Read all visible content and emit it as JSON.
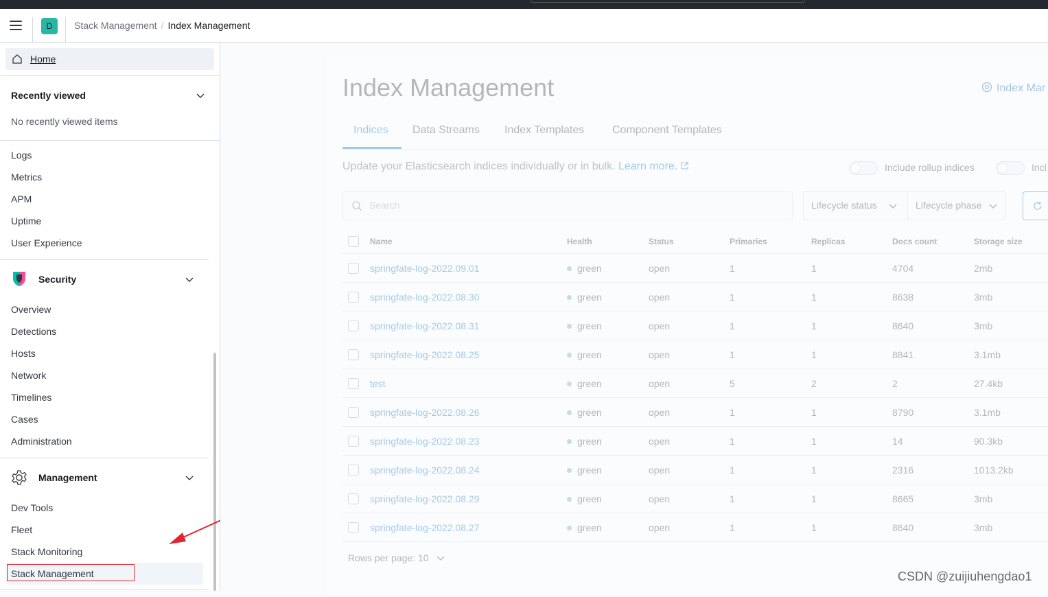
{
  "header": {
    "space_initial": "D",
    "breadcrumbs": [
      "Stack Management",
      "Index Management"
    ]
  },
  "sidebar": {
    "home": "Home",
    "recently_viewed": {
      "title": "Recently viewed",
      "empty": "No recently viewed items"
    },
    "observability_items": [
      "Logs",
      "Metrics",
      "APM",
      "Uptime",
      "User Experience"
    ],
    "security": {
      "title": "Security",
      "items": [
        "Overview",
        "Detections",
        "Hosts",
        "Network",
        "Timelines",
        "Cases",
        "Administration"
      ]
    },
    "management": {
      "title": "Management",
      "items": [
        "Dev Tools",
        "Fleet",
        "Stack Monitoring",
        "Stack Management"
      ]
    }
  },
  "main": {
    "title": "Index Management",
    "docs_link": "Index Mar",
    "tabs": [
      "Indices",
      "Data Streams",
      "Index Templates",
      "Component Templates"
    ],
    "active_tab": "Indices",
    "description": "Update your Elasticsearch indices individually or in bulk.",
    "learn_more": "Learn more.",
    "toggles": [
      "Include rollup indices",
      "Incl"
    ],
    "search_placeholder": "Search",
    "filters": [
      "Lifecycle status",
      "Lifecycle phase"
    ],
    "columns": [
      "Name",
      "Health",
      "Status",
      "Primaries",
      "Replicas",
      "Docs count",
      "Storage size"
    ],
    "rows": [
      [
        "springfate-log-2022.09.01",
        "green",
        "open",
        "1",
        "1",
        "4704",
        "2mb"
      ],
      [
        "springfate-log-2022.08.30",
        "green",
        "open",
        "1",
        "1",
        "8638",
        "3mb"
      ],
      [
        "springfate-log-2022.08.31",
        "green",
        "open",
        "1",
        "1",
        "8640",
        "3mb"
      ],
      [
        "springfate-log-2022.08.25",
        "green",
        "open",
        "1",
        "1",
        "8841",
        "3.1mb"
      ],
      [
        "test",
        "green",
        "open",
        "5",
        "2",
        "2",
        "27.4kb"
      ],
      [
        "springfate-log-2022.08.26",
        "green",
        "open",
        "1",
        "1",
        "8790",
        "3.1mb"
      ],
      [
        "springfate-log-2022.08.23",
        "green",
        "open",
        "1",
        "1",
        "14",
        "90.3kb"
      ],
      [
        "springfate-log-2022.08.24",
        "green",
        "open",
        "1",
        "1",
        "2316",
        "1013.2kb"
      ],
      [
        "springfate-log-2022.08.29",
        "green",
        "open",
        "1",
        "1",
        "8665",
        "3mb"
      ],
      [
        "springfate-log-2022.08.27",
        "green",
        "open",
        "1",
        "1",
        "8640",
        "3mb"
      ]
    ],
    "rows_per_page": "Rows per page: 10"
  },
  "watermark": "CSDN @zuijiuhengdao1",
  "colors": {
    "accent": "#0071c2",
    "health_green": "#54b399",
    "annotation_red": "#e0272f",
    "space_avatar": "#2bb5a4"
  }
}
